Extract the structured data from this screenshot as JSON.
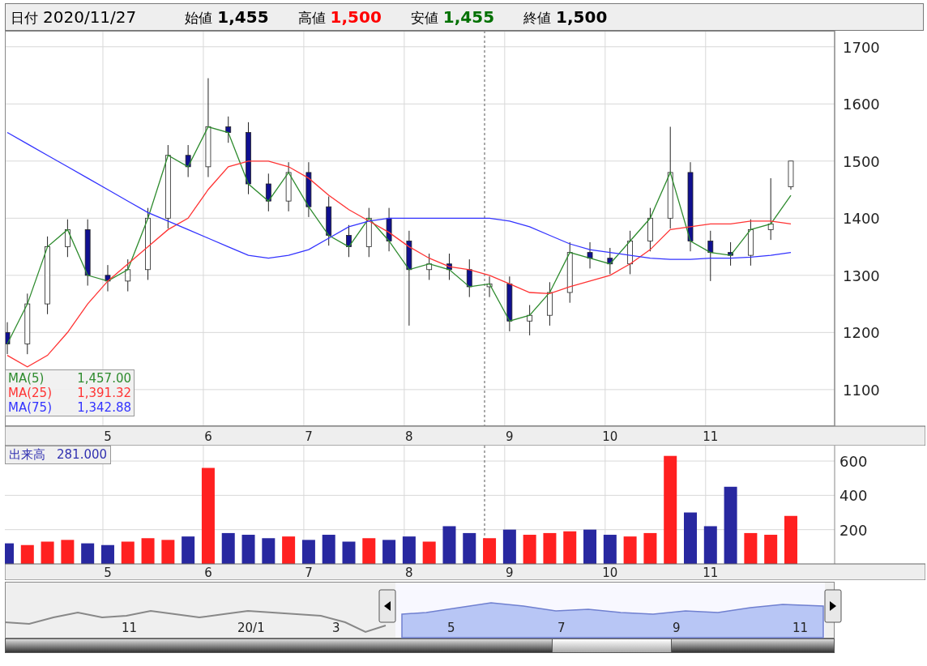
{
  "header": {
    "date_label": "日付",
    "date": "2020/11/27",
    "quotes": [
      {
        "label": "始値",
        "value": "1,455",
        "color": "#000000"
      },
      {
        "label": "高値",
        "value": "1,500",
        "color": "#ff0000"
      },
      {
        "label": "安値",
        "value": "1,455",
        "color": "#007000"
      },
      {
        "label": "終値",
        "value": "1,500",
        "color": "#000000"
      }
    ]
  },
  "price_chart": {
    "chart_data": {
      "type": "candlestick",
      "ylim": [
        1036,
        1728
      ],
      "grid": true,
      "yticks": [
        1100,
        1200,
        1300,
        1400,
        1500,
        1600,
        1700
      ],
      "categories": [
        null,
        null,
        null,
        null,
        null,
        "5",
        null,
        null,
        null,
        null,
        "6",
        null,
        null,
        null,
        null,
        "7",
        null,
        null,
        null,
        null,
        "8",
        null,
        null,
        null,
        null,
        "9",
        null,
        null,
        null,
        null,
        "10",
        null,
        null,
        null,
        null,
        "11",
        null,
        null,
        null,
        null
      ],
      "ohlc": [
        [
          1200,
          1218,
          1162,
          1180
        ],
        [
          1180,
          1268,
          1162,
          1250
        ],
        [
          1250,
          1368,
          1232,
          1350
        ],
        [
          1350,
          1398,
          1332,
          1380
        ],
        [
          1380,
          1398,
          1282,
          1300
        ],
        [
          1300,
          1318,
          1272,
          1290
        ],
        [
          1290,
          1328,
          1272,
          1310
        ],
        [
          1310,
          1418,
          1292,
          1400
        ],
        [
          1400,
          1528,
          1382,
          1510
        ],
        [
          1510,
          1528,
          1472,
          1490
        ],
        [
          1490,
          1645,
          1472,
          1560
        ],
        [
          1560,
          1578,
          1532,
          1550
        ],
        [
          1550,
          1568,
          1442,
          1460
        ],
        [
          1460,
          1478,
          1412,
          1430
        ],
        [
          1430,
          1498,
          1412,
          1480
        ],
        [
          1480,
          1498,
          1402,
          1420
        ],
        [
          1420,
          1438,
          1352,
          1370
        ],
        [
          1370,
          1388,
          1332,
          1350
        ],
        [
          1350,
          1418,
          1332,
          1400
        ],
        [
          1400,
          1418,
          1342,
          1360
        ],
        [
          1360,
          1378,
          1212,
          1310
        ],
        [
          1310,
          1338,
          1292,
          1320
        ],
        [
          1320,
          1338,
          1292,
          1310
        ],
        [
          1310,
          1328,
          1262,
          1280
        ],
        [
          1280,
          1298,
          1262,
          1285
        ],
        [
          1285,
          1298,
          1202,
          1220
        ],
        [
          1220,
          1248,
          1195,
          1230
        ],
        [
          1230,
          1288,
          1212,
          1270
        ],
        [
          1270,
          1358,
          1252,
          1340
        ],
        [
          1340,
          1358,
          1312,
          1330
        ],
        [
          1330,
          1348,
          1302,
          1320
        ],
        [
          1320,
          1378,
          1302,
          1360
        ],
        [
          1360,
          1418,
          1342,
          1400
        ],
        [
          1400,
          1560,
          1382,
          1480
        ],
        [
          1480,
          1498,
          1342,
          1360
        ],
        [
          1360,
          1378,
          1290,
          1340
        ],
        [
          1340,
          1358,
          1317,
          1335
        ],
        [
          1335,
          1398,
          1317,
          1380
        ],
        [
          1380,
          1470,
          1362,
          1390
        ],
        [
          1455,
          1500,
          1450,
          1500
        ]
      ]
    },
    "moving_averages": {
      "legend_values": [
        "1,457.00",
        "1,391.32",
        "1,342.88"
      ],
      "chart_data": {
        "type": "line",
        "ylim": [
          1036,
          1728
        ],
        "series": [
          {
            "name": "MA(5)",
            "color": "#2e8b2e",
            "values": [
              1180,
              1250,
              1350,
              1380,
              1300,
              1290,
              1310,
              1400,
              1510,
              1490,
              1560,
              1550,
              1460,
              1430,
              1480,
              1420,
              1370,
              1350,
              1400,
              1360,
              1310,
              1320,
              1310,
              1280,
              1285,
              1220,
              1230,
              1270,
              1340,
              1330,
              1320,
              1360,
              1400,
              1480,
              1360,
              1340,
              1335,
              1380,
              1390,
              1440
            ]
          },
          {
            "name": "MA(25)",
            "color": "#ff3333",
            "values": [
              1160,
              1140,
              1160,
              1200,
              1250,
              1290,
              1320,
              1350,
              1380,
              1400,
              1450,
              1490,
              1500,
              1500,
              1490,
              1470,
              1440,
              1415,
              1395,
              1375,
              1350,
              1330,
              1315,
              1310,
              1300,
              1285,
              1270,
              1268,
              1280,
              1290,
              1300,
              1320,
              1345,
              1380,
              1385,
              1390,
              1390,
              1395,
              1395,
              1390
            ]
          },
          {
            "name": "MA(75)",
            "color": "#3333ff",
            "values": [
              1550,
              1530,
              1510,
              1490,
              1470,
              1450,
              1430,
              1410,
              1395,
              1380,
              1365,
              1350,
              1335,
              1330,
              1335,
              1345,
              1365,
              1385,
              1395,
              1400,
              1400,
              1400,
              1400,
              1400,
              1400,
              1395,
              1385,
              1370,
              1355,
              1345,
              1340,
              1335,
              1330,
              1328,
              1328,
              1330,
              1330,
              1332,
              1335,
              1340
            ]
          }
        ]
      }
    }
  },
  "volume_chart": {
    "legend_value": "281.000",
    "chart_data": {
      "type": "bar",
      "ylim": [
        0,
        690
      ],
      "yticks": [
        200,
        400,
        600
      ],
      "grid": true,
      "categories": [
        null,
        null,
        null,
        null,
        null,
        "5",
        null,
        null,
        null,
        null,
        "6",
        null,
        null,
        null,
        null,
        "7",
        null,
        null,
        null,
        null,
        "8",
        null,
        null,
        null,
        null,
        "9",
        null,
        null,
        null,
        null,
        "10",
        null,
        null,
        null,
        null,
        "11",
        null,
        null,
        null,
        null
      ],
      "series": [
        {
          "name": "出来高",
          "values": [
            120,
            110,
            130,
            140,
            120,
            110,
            130,
            150,
            140,
            160,
            560,
            180,
            170,
            150,
            160,
            140,
            170,
            130,
            150,
            140,
            160,
            130,
            220,
            180,
            150,
            200,
            170,
            180,
            190,
            200,
            170,
            160,
            180,
            630,
            300,
            220,
            450,
            180,
            170,
            280
          ]
        }
      ]
    }
  },
  "navigator": {
    "labels": [
      "11",
      "20/1",
      "3",
      "5",
      "7",
      "9",
      "11"
    ]
  }
}
